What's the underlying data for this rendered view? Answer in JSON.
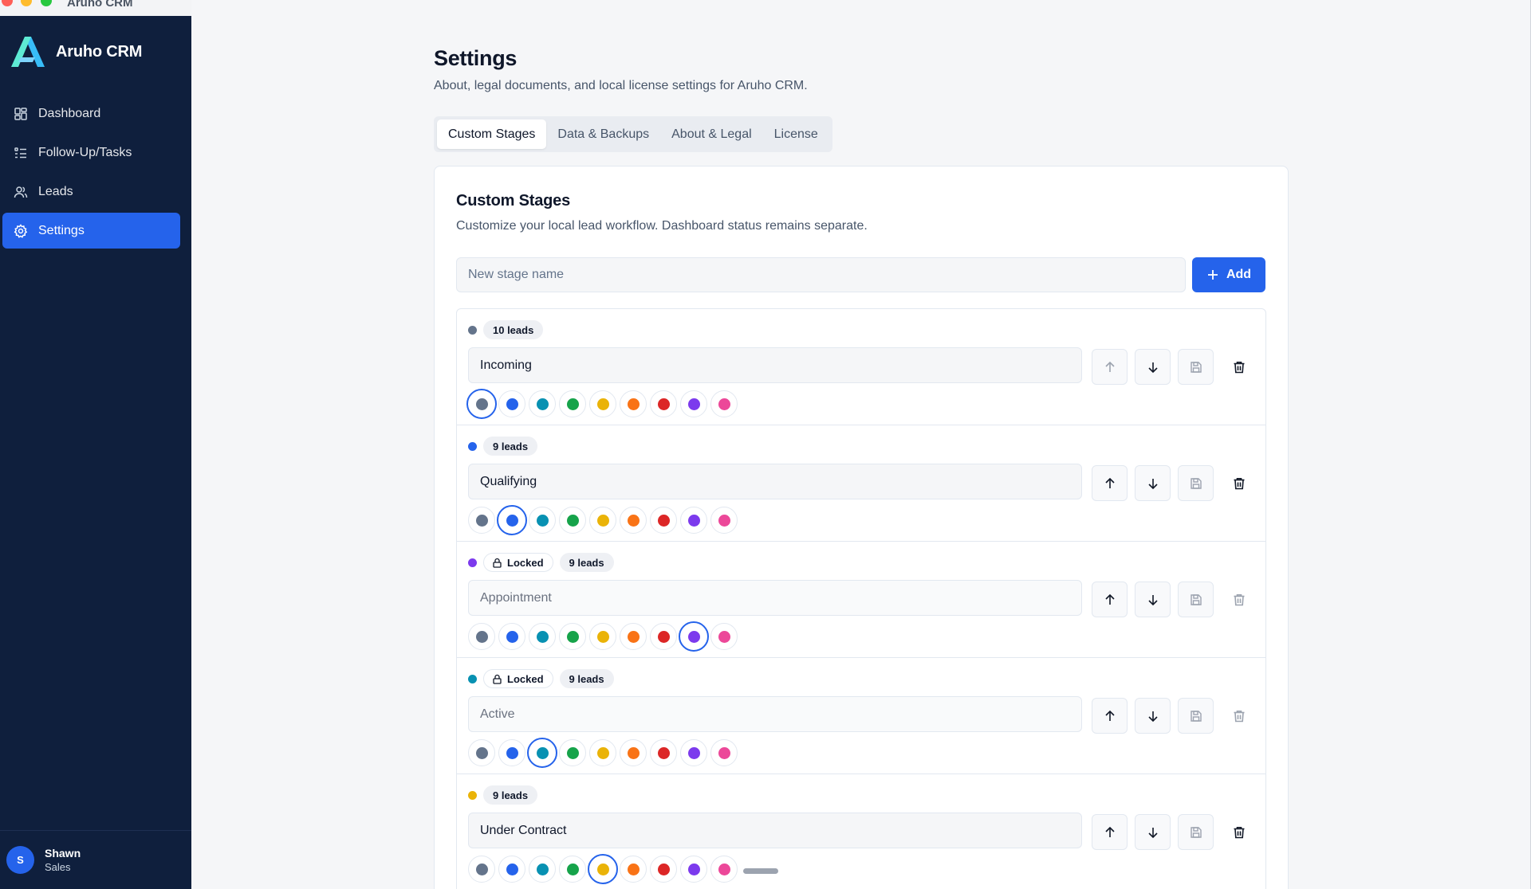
{
  "window": {
    "title": "Aruho CRM"
  },
  "brand": {
    "name": "Aruho CRM"
  },
  "nav": [
    {
      "label": "Dashboard",
      "icon": "dashboard-icon",
      "active": false
    },
    {
      "label": "Follow-Up/Tasks",
      "icon": "tasks-list-icon",
      "active": false
    },
    {
      "label": "Leads",
      "icon": "users-icon",
      "active": false
    },
    {
      "label": "Settings",
      "icon": "gear-icon",
      "active": true
    }
  ],
  "user": {
    "initial": "S",
    "name": "Shawn",
    "role": "Sales"
  },
  "page": {
    "title": "Settings",
    "subtitle": "About, legal documents, and local license settings for Aruho CRM."
  },
  "tabs": [
    {
      "label": "Custom Stages",
      "active": true
    },
    {
      "label": "Data & Backups",
      "active": false
    },
    {
      "label": "About & Legal",
      "active": false
    },
    {
      "label": "License",
      "active": false
    }
  ],
  "card": {
    "title": "Custom Stages",
    "subtitle": "Customize your local lead workflow. Dashboard status remains separate.",
    "new_stage_placeholder": "New stage name",
    "add_label": "Add"
  },
  "palette": [
    "#64748b",
    "#2563eb",
    "#0891b2",
    "#16a34a",
    "#eab308",
    "#f97316",
    "#dc2626",
    "#7c3aed",
    "#ec4899"
  ],
  "stages": [
    {
      "name": "Incoming",
      "leads": "10 leads",
      "locked": false,
      "locked_label": "",
      "color_index": 0
    },
    {
      "name": "Qualifying",
      "leads": "9 leads",
      "locked": false,
      "locked_label": "",
      "color_index": 1
    },
    {
      "name": "Appointment",
      "leads": "9 leads",
      "locked": true,
      "locked_label": "Locked",
      "color_index": 7
    },
    {
      "name": "Active",
      "leads": "9 leads",
      "locked": true,
      "locked_label": "Locked",
      "color_index": 2
    },
    {
      "name": "Under Contract",
      "leads": "9 leads",
      "locked": false,
      "locked_label": "",
      "color_index": 4
    }
  ]
}
